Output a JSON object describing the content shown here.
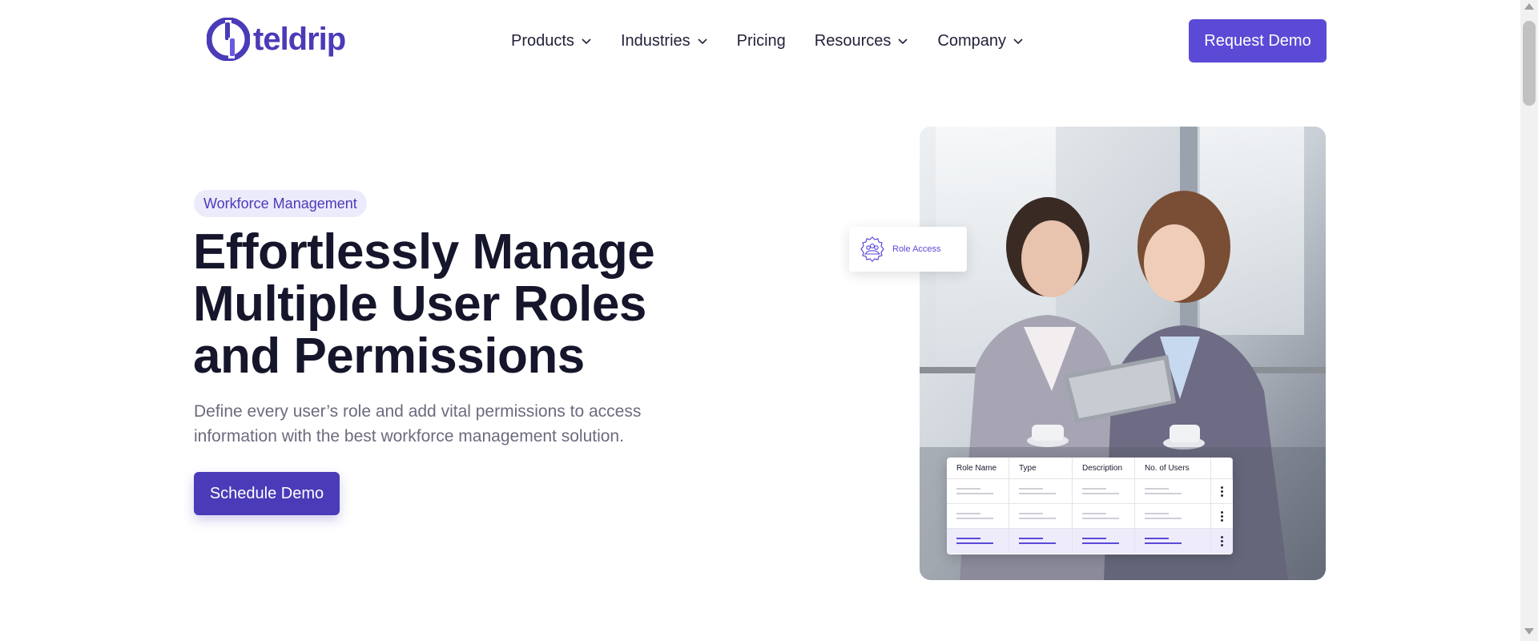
{
  "brand": {
    "name": "teldrip",
    "color": "#4a3bb8",
    "accent": "#5b4ad6"
  },
  "nav": {
    "items": [
      {
        "label": "Products",
        "has_dropdown": true
      },
      {
        "label": "Industries",
        "has_dropdown": true
      },
      {
        "label": "Pricing",
        "has_dropdown": false
      },
      {
        "label": "Resources",
        "has_dropdown": true
      },
      {
        "label": "Company",
        "has_dropdown": true
      }
    ],
    "cta": "Request Demo"
  },
  "hero": {
    "badge": "Workforce Management",
    "title": "Effortlessly Manage Multiple User Roles and Permissions",
    "description": "Define every user’s role and add vital permissions to access information with the best workforce management solution.",
    "cta": "Schedule Demo"
  },
  "illustration": {
    "role_card_label": "Role Access",
    "table_headers": [
      "Role Name",
      "Type",
      "Description",
      "No. of Users"
    ]
  }
}
